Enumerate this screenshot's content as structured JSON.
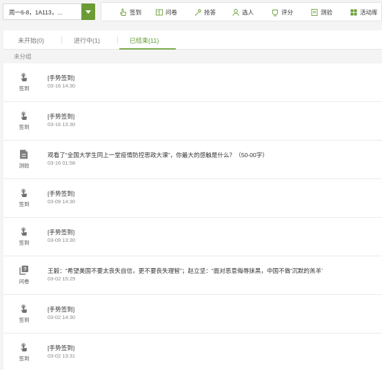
{
  "course": {
    "selected": "周一6-8，1A113，..."
  },
  "toolbar": [
    {
      "label": "签到",
      "icon": "hand-icon"
    },
    {
      "label": "问卷",
      "icon": "book-icon"
    },
    {
      "label": "抢答",
      "icon": "wrench-icon"
    },
    {
      "label": "选人",
      "icon": "person-icon"
    },
    {
      "label": "评分",
      "icon": "award-icon"
    },
    {
      "label": "测验",
      "icon": "document-icon"
    },
    {
      "label": "活动库",
      "icon": "grid-icon"
    }
  ],
  "tabs": [
    {
      "label": "未开始(0)",
      "active": false
    },
    {
      "label": "进行中(1)",
      "active": false
    },
    {
      "label": "已结束(11)",
      "active": true
    }
  ],
  "group": {
    "label": "未分组"
  },
  "activities": [
    {
      "type": "签到",
      "icon": "hand-touch-icon",
      "title": "[手势签到]",
      "date": "03-16 14:30"
    },
    {
      "type": "签到",
      "icon": "hand-touch-icon",
      "title": "[手势签到]",
      "date": "03-16 13:30"
    },
    {
      "type": "测验",
      "icon": "quiz-icon",
      "title": "观看了“全国大学生同上一堂疫情防控思政大课”，你最大的感触是什么？（50-00字）",
      "date": "03-16 01:58"
    },
    {
      "type": "签到",
      "icon": "hand-touch-icon",
      "title": "[手势签到]",
      "date": "03-09 14:30"
    },
    {
      "type": "签到",
      "icon": "hand-touch-icon",
      "title": "[手势签到]",
      "date": "03-09 13:30"
    },
    {
      "type": "问卷",
      "icon": "question-icon",
      "title": "王毅：“希望美国不要太丧失自信，更不要丧失理智”；赵立坚：“面对恶意侮辱抹黑，中国不做‘沉默的羔羊’",
      "date": "03-02 15:29"
    },
    {
      "type": "签到",
      "icon": "hand-touch-icon",
      "title": "[手势签到]",
      "date": "03-02 14:30"
    },
    {
      "type": "签到",
      "icon": "hand-touch-icon",
      "title": "[手势签到]",
      "date": "03-02 13:31"
    }
  ],
  "colors": {
    "accent": "#6a9b34",
    "tab_active": "#5f9a2d"
  }
}
